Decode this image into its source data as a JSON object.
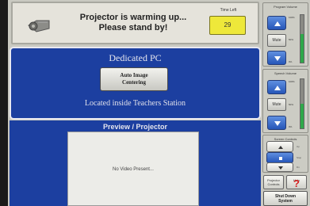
{
  "banner": {
    "message_line1": "Projector is warming up...",
    "message_line2": "Please stand by!",
    "time_left_label": "Time Left",
    "time_left_value": "29",
    "icon": "projector-icon"
  },
  "dedicated_pc": {
    "title": "Dedicated PC",
    "auto_image_line1": "Auto Image",
    "auto_image_line2": "Centering",
    "location": "Located inside Teachers Station"
  },
  "preview": {
    "title": "Preview / Projector",
    "message": "No Video Present..."
  },
  "program_volume": {
    "title": "Program Volume",
    "up_icon": "triangle-up-icon",
    "down_icon": "triangle-down-icon",
    "mute_label": "Mute",
    "level_fraction": 0.6,
    "tick_top": "100%",
    "tick_mid": "50%",
    "tick_bottom": "0%"
  },
  "speech_volume": {
    "title": "Speech Volume",
    "up_icon": "triangle-up-icon",
    "down_icon": "triangle-down-icon",
    "mute_label": "Mute",
    "level_fraction": 0.5,
    "tick_top": "100%",
    "tick_mid": "50%",
    "tick_bottom": "0%"
  },
  "screen_controls": {
    "title": "Screen Controls",
    "up_label": "Up",
    "stop_label": "Stop",
    "down_label": "Dn"
  },
  "projector_controls_label_line1": "Projector",
  "projector_controls_label_line2": "Controls",
  "help_label": "Help",
  "shutdown_line1": "Shut Down",
  "shutdown_line2": "System",
  "colors": {
    "panel_blue": "#1c3fa0",
    "time_yellow": "#eee83a",
    "button_blue": "#2656b8",
    "meter_green": "#2fa84a",
    "help_red": "#d62020"
  }
}
